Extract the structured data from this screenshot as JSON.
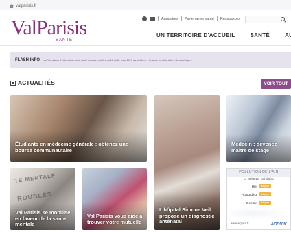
{
  "topbar": {
    "site": "valparisis.fr"
  },
  "logo": {
    "brand": "ValParisis",
    "tagline": "SANTÉ"
  },
  "utils": {
    "links": [
      "Annuaires",
      "Partenaires santé",
      "Ressources"
    ]
  },
  "search": {
    "placeholder": ""
  },
  "nav": {
    "items": [
      "UN TERRITOIRE D'ACCUEIL",
      "SANTÉ",
      "AUTONOMIE"
    ]
  },
  "flash": {
    "label": "FLASH INFO",
    "text": "Les \"Semaines d'information sur la santé mentale\" ont lieu du 18 au 31 mars 2019 sur le thème « la santé mentale à l'ère du numérique »"
  },
  "news": {
    "title": "ACTUALITÉS",
    "see_all": "VOIR TOUT",
    "cards": [
      {
        "caption": "Étudiants en médecine générale : obtenez une bourse communautaire"
      },
      {
        "caption": "L'hôpital Simone Veil propose un diagnostic anténatal"
      },
      {
        "caption": "Médecin : devenez maître de stage"
      },
      {
        "caption": "Val Parisis se mobilise en faveur de la santé mentale"
      },
      {
        "caption": "Val Parisis vous aide à trouver votre mutuelle"
      }
    ],
    "card4_stamp_1": "TE MENTALE",
    "card4_stamp_2": "ROUBLES"
  },
  "air": {
    "title": "POLLUTION DE L'AIR",
    "date": "Le 28/03/19 - Val d'Oise",
    "rows": [
      {
        "label": "Hier",
        "value": "Moyen"
      },
      {
        "label": "Aujourd'hui",
        "value": "Moyen"
      },
      {
        "label": "Demain",
        "value": "Moyen"
      }
    ],
    "url": "www.airparif.fr",
    "brand": "AIRPARIF"
  }
}
